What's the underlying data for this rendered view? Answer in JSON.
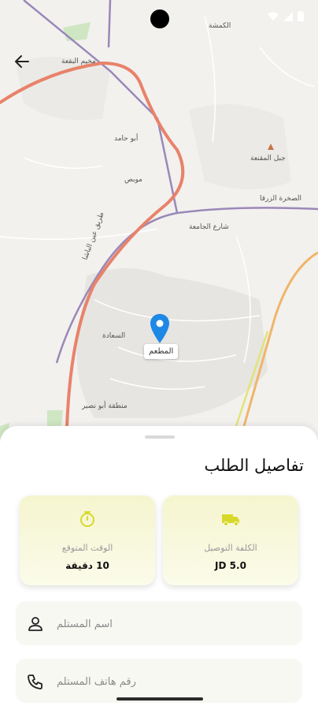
{
  "map": {
    "labels": {
      "top_right": "الكمشة",
      "top_left": "مخيم البقعة",
      "abu_hamed": "أبو حامد",
      "muwais": "موبص",
      "jabal_muqaffa": "جبل المقنعة",
      "road_jamia": "شارع الجامعة",
      "road_zarqa": "الصخرة الزرقا",
      "saada": "السعادة",
      "abu_nusair": "منطقة أبو نصير",
      "road_vertical": "طريق عين الباشا"
    },
    "pin_label": "المطعم"
  },
  "sheet": {
    "title": "تفاصيل الطلب",
    "cards": [
      {
        "icon": "truck-icon",
        "label": "الكلفة التوصيل",
        "value": "5.0 JD"
      },
      {
        "icon": "timer-icon",
        "label": "الوقت المتوقع",
        "value": "10 دقيقة"
      }
    ],
    "fields": [
      {
        "icon": "person-icon",
        "placeholder": "اسم المستلم",
        "value": ""
      },
      {
        "icon": "phone-icon",
        "placeholder": "رقم هاتف المستلم",
        "value": ""
      }
    ]
  },
  "colors": {
    "accent_yellow": "#d8d82a",
    "map_pin": "#1e88e5",
    "major_road": "#e8826a",
    "secondary_road": "#9a88b8"
  }
}
